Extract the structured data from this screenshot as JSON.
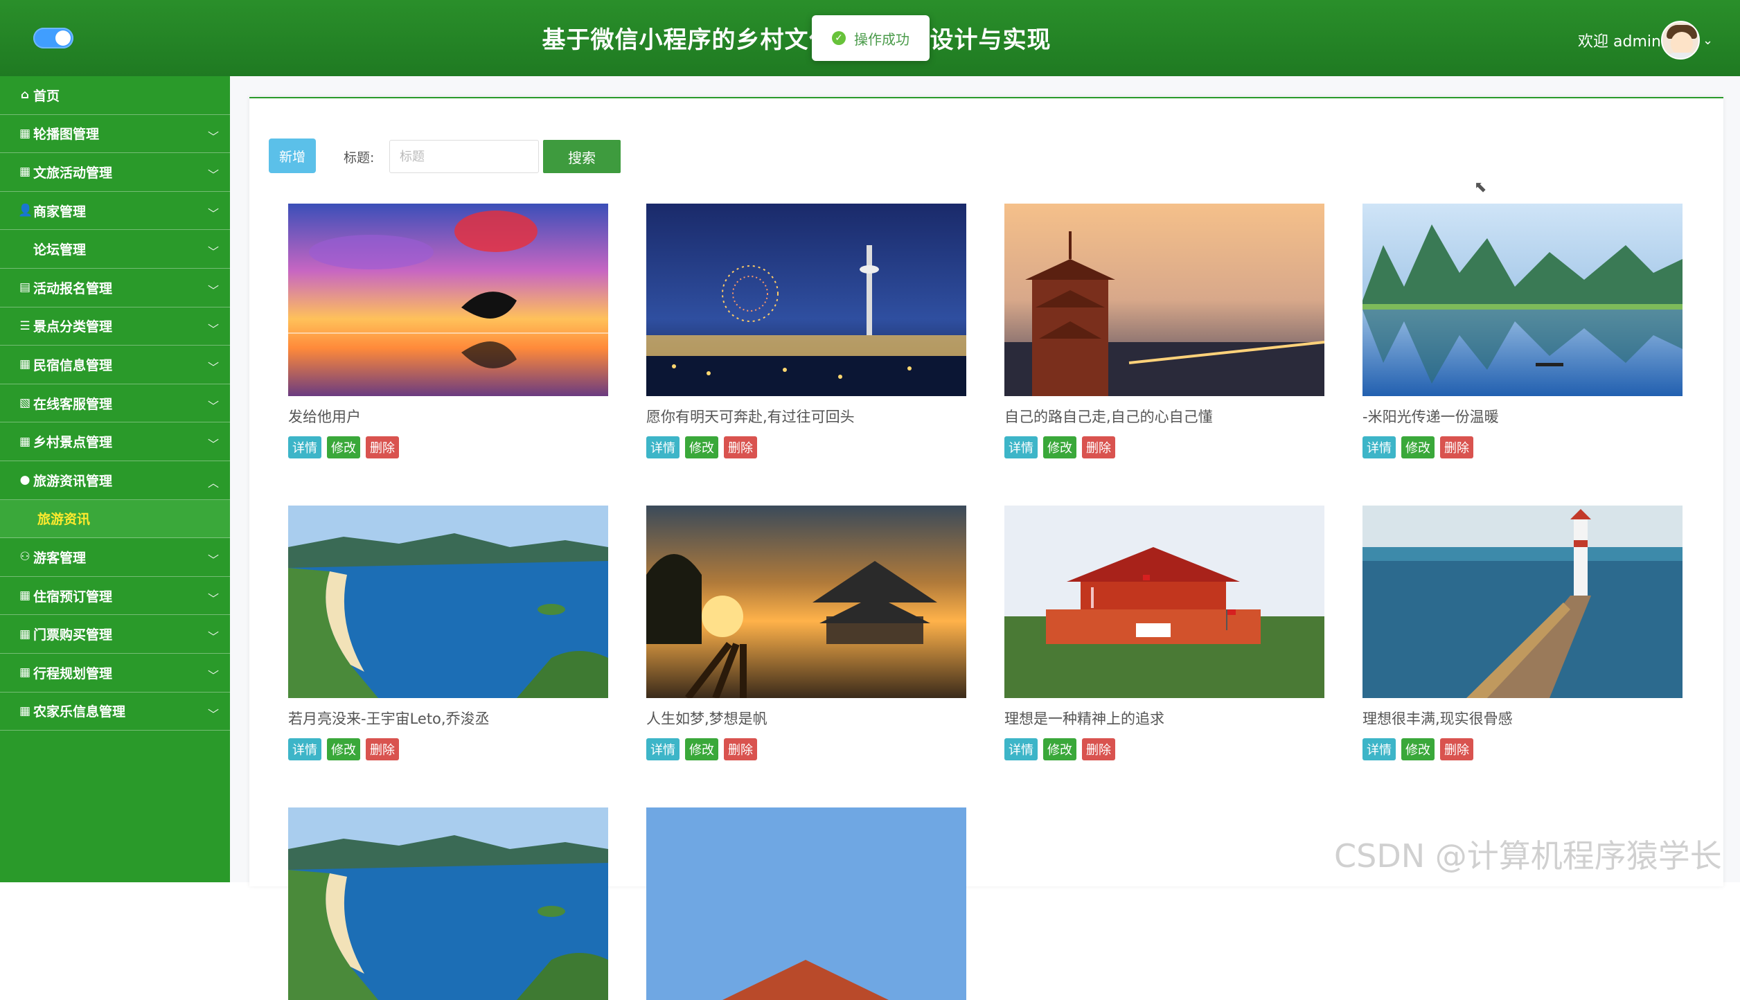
{
  "header": {
    "title": "基于微信小程序的乡村文化旅游系统设计与实现",
    "welcome": "欢迎 admin",
    "toast": "操作成功"
  },
  "sidebar": {
    "items": [
      {
        "icon": "home-icon",
        "label": "首页",
        "expandable": false
      },
      {
        "icon": "grid-icon",
        "label": "轮播图管理",
        "expandable": true
      },
      {
        "icon": "grid-icon",
        "label": "文旅活动管理",
        "expandable": true
      },
      {
        "icon": "user-icon",
        "label": "商家管理",
        "expandable": true
      },
      {
        "icon": "",
        "label": "论坛管理",
        "expandable": true
      },
      {
        "icon": "printer-icon",
        "label": "活动报名管理",
        "expandable": true
      },
      {
        "icon": "list-icon",
        "label": "景点分类管理",
        "expandable": true
      },
      {
        "icon": "grid-icon",
        "label": "民宿信息管理",
        "expandable": true
      },
      {
        "icon": "document-icon",
        "label": "在线客服管理",
        "expandable": true
      },
      {
        "icon": "grid-icon",
        "label": "乡村景点管理",
        "expandable": true
      },
      {
        "icon": "drop-icon",
        "label": "旅游资讯管理",
        "expandable": true,
        "open": true
      },
      {
        "icon": "user-outline-icon",
        "label": "游客管理",
        "expandable": true
      },
      {
        "icon": "grid-icon",
        "label": "住宿预订管理",
        "expandable": true
      },
      {
        "icon": "grid-icon",
        "label": "门票购买管理",
        "expandable": true
      },
      {
        "icon": "grid-icon",
        "label": "行程规划管理",
        "expandable": true
      },
      {
        "icon": "grid-icon",
        "label": "农家乐信息管理",
        "expandable": true
      }
    ],
    "submenu": "旅游资讯"
  },
  "toolbar": {
    "add_label": "新增",
    "title_label": "标题:",
    "search_placeholder": "标题",
    "search_label": "搜索"
  },
  "actions": {
    "detail": "详情",
    "edit": "修改",
    "delete": "删除"
  },
  "cards": [
    {
      "caption": "发给他用户",
      "image": "dolphin-sunset"
    },
    {
      "caption": "愿你有明天可奔赴,有过往可回头",
      "image": "city-fireworks"
    },
    {
      "caption": "自己的路自己走,自己的心自己懂",
      "image": "pavilion-dusk"
    },
    {
      "caption": "-米阳光传递一份温暖",
      "image": "karst-river"
    },
    {
      "caption": "若月亮没来-王宇宙Leto,乔浚丞",
      "image": "coast-bay"
    },
    {
      "caption": "人生如梦,梦想是帆",
      "image": "temple-sunset"
    },
    {
      "caption": "理想是一种精神上的追求",
      "image": "tiananmen"
    },
    {
      "caption": "理想很丰满,现实很骨感",
      "image": "lighthouse"
    },
    {
      "caption": "",
      "image": "coast-bay"
    },
    {
      "caption": "",
      "image": "temple-sky"
    }
  ],
  "watermark": "CSDN @计算机程序猿学长",
  "colors": {
    "primary": "#2a9a2a",
    "header": "#1f7a22",
    "highlight": "#ffea2e",
    "detail": "#3db5c8",
    "edit": "#3aa83a",
    "delete": "#d9534f",
    "add": "#5bc0e9"
  }
}
